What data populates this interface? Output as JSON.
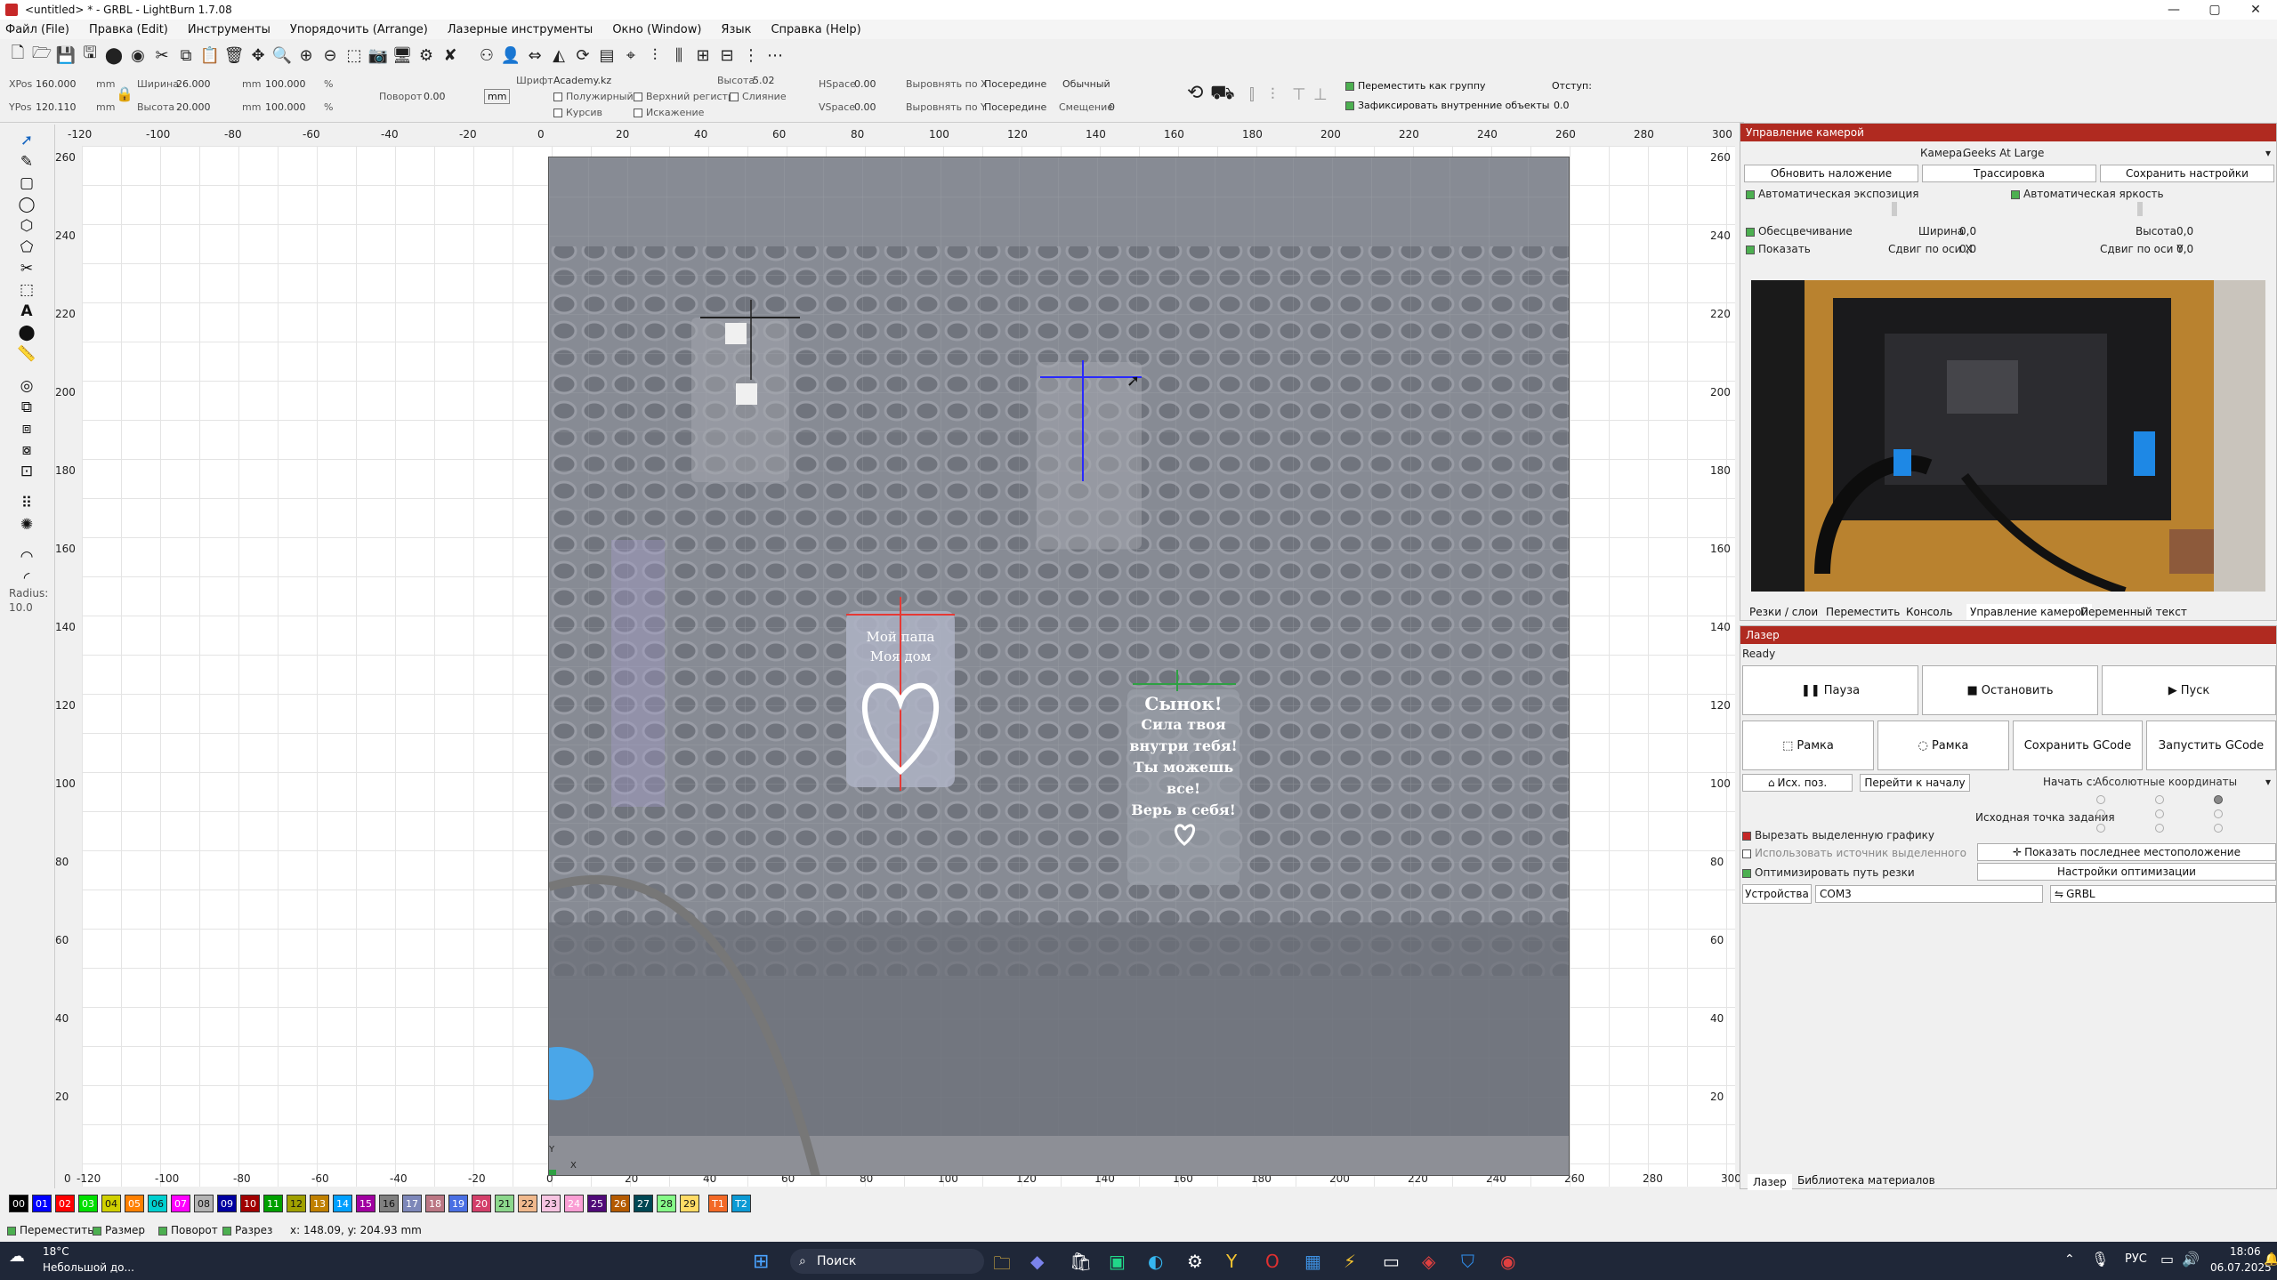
{
  "window": {
    "title": "<untitled> * - GRBL - LightBurn 1.7.08",
    "minimize": "—",
    "maximize": "▢",
    "close": "✕"
  },
  "menu": [
    "Файл (File)",
    "Правка (Edit)",
    "Инструменты",
    "Упорядочить (Arrange)",
    "Лазерные инструменты",
    "Окно (Window)",
    "Язык",
    "Справка (Help)"
  ],
  "props": {
    "xpos_label": "XPos",
    "xpos_value": "160.000",
    "ypos_label": "YPos",
    "ypos_value": "120.110",
    "unit": "mm",
    "width_label": "Ширина",
    "width_value": "26.000",
    "height_label": "Высота",
    "height_value": "20.000",
    "scale_w": "100.000",
    "scale_h": "100.000",
    "pct": "%",
    "rotate_label": "Поворот",
    "rotate_value": "0.00",
    "mm_btn": "mm",
    "font_label": "Шрифт",
    "font_value": "Academy.kz",
    "textheight_label": "Высота",
    "textheight_value": "5.02",
    "hspace_label": "HSpace",
    "hspace_value": "0.00",
    "vspace_label": "VSpace",
    "vspace_value": "0.00",
    "alignx_label": "Выровнять по X",
    "alignx_value": "Посередине",
    "aligny_label": "Выровнять по Y",
    "aligny_value": "Посередине",
    "style_value": "Обычный",
    "offset_label": "Смещение",
    "offset_value": "0",
    "bold": "Полужирный",
    "italic": "Курсив",
    "upper": "Верхний регистр",
    "distort": "Искажение",
    "weld": "Слияние",
    "move_group": "Переместить как группу",
    "fix_inner": "Зафиксировать внутренние объекты",
    "indent_label": "Отступ:",
    "indent_value": "0.0"
  },
  "ruler": {
    "top": [
      "-120",
      "-100",
      "-80",
      "-60",
      "-40",
      "-20",
      "0",
      "20",
      "40",
      "60",
      "80",
      "100",
      "120",
      "140",
      "160",
      "180",
      "200",
      "220",
      "240",
      "260",
      "280",
      "300"
    ],
    "left": [
      "260",
      "240",
      "220",
      "200",
      "180",
      "160",
      "140",
      "120",
      "100",
      "80",
      "60",
      "40",
      "20"
    ],
    "right": [
      "260",
      "240",
      "220",
      "200",
      "180",
      "160",
      "140",
      "120",
      "100",
      "80",
      "60",
      "40",
      "20"
    ],
    "bottom": [
      "0",
      "-120",
      "-100",
      "-80",
      "-60",
      "-40",
      "-20",
      "0",
      "20",
      "40",
      "60",
      "80",
      "100",
      "120",
      "140",
      "160",
      "180",
      "200",
      "220",
      "240",
      "260",
      "280",
      "300"
    ]
  },
  "radius": {
    "label": "Radius:",
    "value": "10.0"
  },
  "bed_labels": {
    "left_text": [
      "Мой папа",
      "Моя дом"
    ],
    "right_text": [
      "Сынок!",
      "Сила твоя",
      "внутри тебя!",
      "Ты можешь",
      "все!",
      "Верь в себя!"
    ],
    "axis_y": "Y",
    "axis_x": "X"
  },
  "swatches": [
    {
      "l": "00",
      "c": "#000000"
    },
    {
      "l": "01",
      "c": "#0000ff"
    },
    {
      "l": "02",
      "c": "#ff0000"
    },
    {
      "l": "03",
      "c": "#00e000"
    },
    {
      "l": "04",
      "c": "#d0d000"
    },
    {
      "l": "05",
      "c": "#ff8000"
    },
    {
      "l": "06",
      "c": "#00d0d0"
    },
    {
      "l": "07",
      "c": "#ff00ff"
    },
    {
      "l": "08",
      "c": "#b4b4b4"
    },
    {
      "l": "09",
      "c": "#0000a0"
    },
    {
      "l": "10",
      "c": "#a00000"
    },
    {
      "l": "11",
      "c": "#00a000"
    },
    {
      "l": "12",
      "c": "#a0a000"
    },
    {
      "l": "13",
      "c": "#c08000"
    },
    {
      "l": "14",
      "c": "#00a0ff"
    },
    {
      "l": "15",
      "c": "#a000a0"
    },
    {
      "l": "16",
      "c": "#808080"
    },
    {
      "l": "17",
      "c": "#7d87b9"
    },
    {
      "l": "18",
      "c": "#bb7784"
    },
    {
      "l": "19",
      "c": "#4a6fe3"
    },
    {
      "l": "20",
      "c": "#d33f6a"
    },
    {
      "l": "21",
      "c": "#8cd78c"
    },
    {
      "l": "22",
      "c": "#f0b98d"
    },
    {
      "l": "23",
      "c": "#f6c4e1"
    },
    {
      "l": "24",
      "c": "#fa9ed4"
    },
    {
      "l": "25",
      "c": "#500a78"
    },
    {
      "l": "26",
      "c": "#b45a00"
    },
    {
      "l": "27",
      "c": "#004754"
    },
    {
      "l": "28",
      "c": "#86fa88"
    },
    {
      "l": "29",
      "c": "#ffdb66"
    },
    {
      "l": "T1",
      "c": "#f36926"
    },
    {
      "l": "T2",
      "c": "#0c9ad4"
    }
  ],
  "statusbar": {
    "move": "Переместить",
    "size": "Размер",
    "rotate": "Поворот",
    "cut": "Разрез",
    "coords": "x: 148.09, y: 204.93 mm"
  },
  "camera_panel": {
    "title": "Управление камерой",
    "camera_label": "Камера:",
    "camera_value": "Geeks At Large",
    "update_overlay": "Обновить наложение",
    "trace": "Трассировка",
    "save_settings": "Сохранить настройки",
    "auto_exposure": "Автоматическая экспозиция",
    "auto_brightness": "Автоматическая яркость",
    "fade": "Обесцвечивание",
    "show": "Показать",
    "width_label": "Ширина",
    "width_value": "0,0",
    "height_label": "Высота",
    "height_value": "0,0",
    "shiftx_label": "Сдвиг по оси X",
    "shiftx_value": "0,0",
    "shifty_label": "Сдвиг по оси Y",
    "shifty_value": "0,0",
    "tabs": [
      "Резки / слои",
      "Переместить",
      "Консоль",
      "Управление камерой",
      "Переменный текст"
    ]
  },
  "laser_panel": {
    "title": "Лазер",
    "status": "Ready",
    "pause": "Пауза",
    "stop": "Остановить",
    "start": "Пуск",
    "frame1": "Рамка",
    "frame2": "Рамка",
    "save_gcode": "Сохранить GCode",
    "run_gcode": "Запустить GCode",
    "home": "Исх. поз.",
    "goto_origin": "Перейти к началу",
    "start_from_label": "Начать с:",
    "start_from_value": "Абсолютные координаты",
    "job_origin": "Исходная точка задания",
    "cut_selected": "Вырезать выделенную графику",
    "use_selection_origin": "Использовать источник выделенного",
    "show_last": "Показать последнее местоположение",
    "optimize": "Оптимизировать путь резки",
    "opt_settings": "Настройки оптимизации",
    "devices": "Устройства",
    "port": "COM3",
    "profile": "GRBL",
    "tabs": [
      "Лазер",
      "Библиотека материалов"
    ]
  },
  "taskbar": {
    "temp": "18°C",
    "weather": "Небольшой до...",
    "search": "Поиск",
    "lang": "РУС",
    "time": "18:06",
    "date": "06.07.2025"
  }
}
